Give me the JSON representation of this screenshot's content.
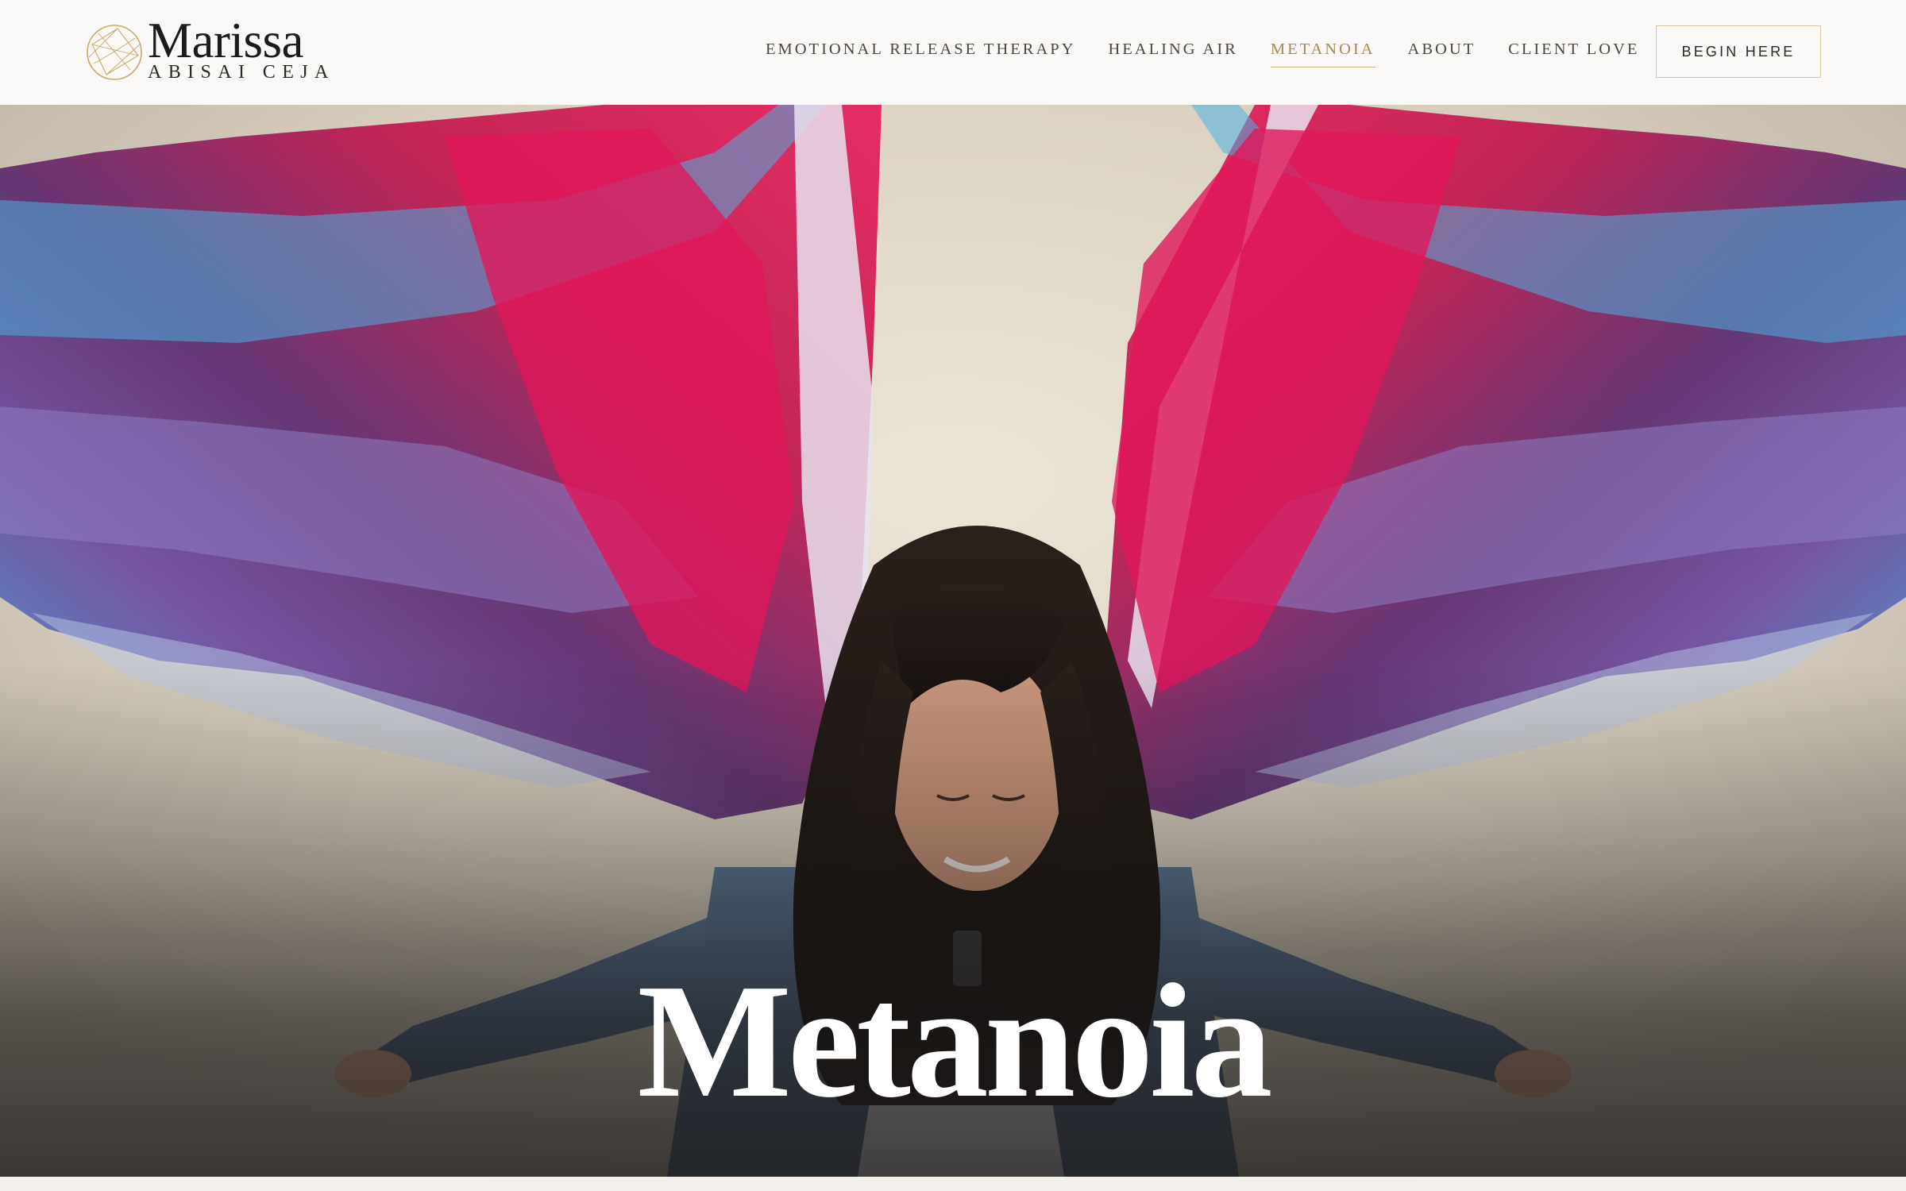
{
  "header": {
    "logo": {
      "name": "Marissa",
      "subname": "ABISAI CEJA",
      "accent_color": "#c9a96a"
    },
    "nav": [
      {
        "label": "EMOTIONAL RELEASE THERAPY",
        "active": false
      },
      {
        "label": "HEALING AIR",
        "active": false
      },
      {
        "label": "METANOIA",
        "active": true
      },
      {
        "label": "ABOUT",
        "active": false
      },
      {
        "label": "CLIENT LOVE",
        "active": false
      }
    ],
    "cta_label": "BEGIN HERE"
  },
  "hero": {
    "title": "Metanoia",
    "image": "person-with-painted-angel-wings-mural"
  },
  "colors": {
    "background": "#faf9f7",
    "nav_text": "#4a4642",
    "nav_active": "#a9874f",
    "cta_border": "#d8c6a3",
    "hero_title": "#ffffff"
  }
}
